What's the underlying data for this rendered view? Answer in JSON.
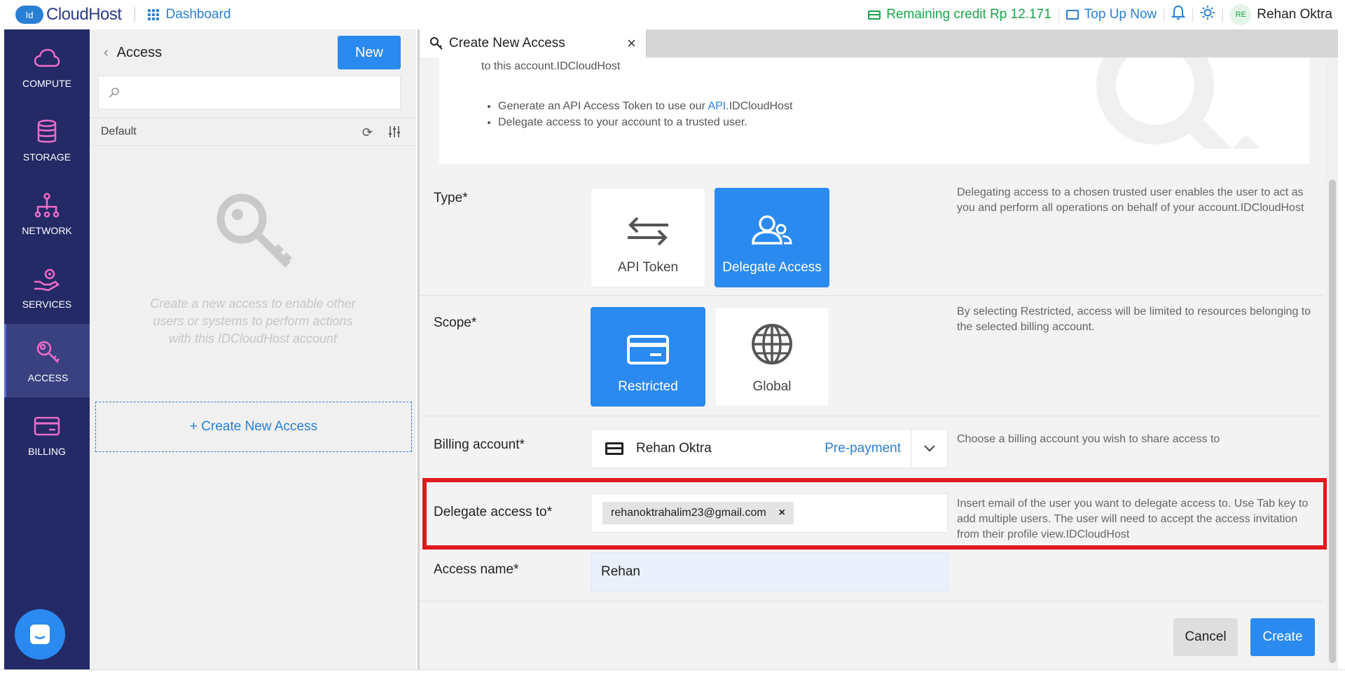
{
  "topbar": {
    "logo_badge": "Id",
    "logo_text": "CloudHost",
    "dashboard_label": "Dashboard",
    "credit_text": "Remaining credit Rp 12.171",
    "topup_label": "Top Up Now",
    "avatar_initials": "RE",
    "user_name": "Rehan Oktra"
  },
  "sidebar": {
    "items": [
      {
        "label": "COMPUTE",
        "icon": "cloud-icon"
      },
      {
        "label": "STORAGE",
        "icon": "database-icon"
      },
      {
        "label": "NETWORK",
        "icon": "network-icon"
      },
      {
        "label": "SERVICES",
        "icon": "services-icon"
      },
      {
        "label": "ACCESS",
        "icon": "key-icon"
      },
      {
        "label": "BILLING",
        "icon": "card-icon"
      }
    ],
    "active": "ACCESS"
  },
  "access_panel": {
    "title": "Access",
    "new_button": "New",
    "search_placeholder": "",
    "group_label": "Default",
    "empty_text": "Create a new access to enable other users or systems to perform actions with this IDCloudHost account",
    "create_link": "+ Create New Access"
  },
  "tab": {
    "title": "Create New Access"
  },
  "intro": {
    "line_top": "to this account.IDCloudHost",
    "bullet1_before": "Generate an API Access Token to use our ",
    "bullet1_link": "API",
    "bullet1_after": ".IDCloudHost",
    "bullet2": "Delegate access to your account to a trusted user."
  },
  "form": {
    "type": {
      "label": "Type*",
      "options": [
        "API Token",
        "Delegate Access"
      ],
      "selected": "Delegate Access",
      "help": "Delegating access to a chosen trusted user enables the user to act as you and perform all operations on behalf of your account.IDCloudHost"
    },
    "scope": {
      "label": "Scope*",
      "options": [
        "Restricted",
        "Global"
      ],
      "selected": "Restricted",
      "help": "By selecting Restricted, access will be limited to resources belonging to the selected billing account."
    },
    "billing": {
      "label": "Billing account*",
      "name": "Rehan Oktra",
      "plan": "Pre-payment",
      "help": "Choose a billing account you wish to share access to"
    },
    "delegate": {
      "label": "Delegate access to*",
      "chip": "rehanoktrahalim23@gmail.com",
      "help": "Insert email of the user you want to delegate access to. Use Tab key to add multiple users. The user will need to accept the access invitation from their profile view.IDCloudHost"
    },
    "access_name": {
      "label": "Access name*",
      "value": "Rehan"
    }
  },
  "actions": {
    "cancel": "Cancel",
    "create": "Create"
  },
  "colors": {
    "accent": "#2a8af0",
    "sidebar_bg": "#232a66",
    "credit_green": "#1aa34a",
    "highlight_red": "#e0191f"
  }
}
